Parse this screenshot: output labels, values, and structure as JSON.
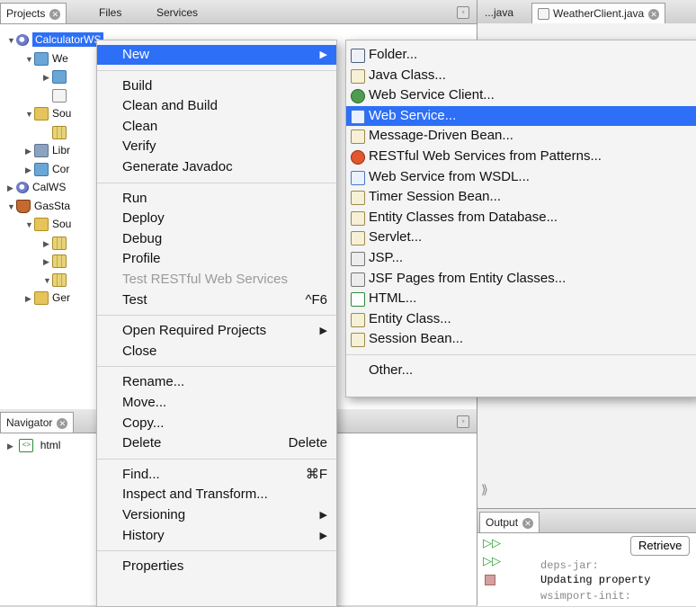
{
  "left_tabs": [
    {
      "label": "Projects",
      "closable": true,
      "active": true
    },
    {
      "label": "Files",
      "closable": false,
      "active": false
    },
    {
      "label": "Services",
      "closable": false,
      "active": false
    }
  ],
  "editor_tabs": [
    {
      "label": "...java"
    },
    {
      "label": "WeatherClient.java",
      "closable": true
    }
  ],
  "project_tree": [
    {
      "indent": 0,
      "expanded": true,
      "icon": "globe-icon",
      "label": "CalculatorWS",
      "selected": true
    },
    {
      "indent": 1,
      "expanded": true,
      "icon": "folder-blue-icon",
      "label": "We"
    },
    {
      "indent": 2,
      "expanded": false,
      "icon": "folder-blue-icon",
      "label": ""
    },
    {
      "indent": 2,
      "expanded": null,
      "icon": "file-icon",
      "label": ""
    },
    {
      "indent": 1,
      "expanded": true,
      "icon": "folder-gold-icon",
      "label": "Sou"
    },
    {
      "indent": 2,
      "expanded": null,
      "icon": "package-icon",
      "label": ""
    },
    {
      "indent": 1,
      "expanded": false,
      "icon": "library-icon",
      "label": "Libr"
    },
    {
      "indent": 1,
      "expanded": false,
      "icon": "folder-blue-icon",
      "label": "Cor"
    },
    {
      "indent": 0,
      "expanded": false,
      "icon": "globe-icon",
      "label": "CalWS"
    },
    {
      "indent": 0,
      "expanded": true,
      "icon": "coffee-cup-icon",
      "label": "GasSta"
    },
    {
      "indent": 1,
      "expanded": true,
      "icon": "folder-gold-icon",
      "label": "Sou"
    },
    {
      "indent": 2,
      "expanded": false,
      "icon": "package-icon",
      "label": ""
    },
    {
      "indent": 2,
      "expanded": false,
      "icon": "package-icon",
      "label": ""
    },
    {
      "indent": 2,
      "expanded": true,
      "icon": "package-icon",
      "label": ""
    },
    {
      "indent": 1,
      "expanded": false,
      "icon": "folder-gold-icon",
      "label": "Ger"
    }
  ],
  "navigator": {
    "tab_label": "Navigator",
    "root": {
      "icon": "html-icon",
      "label": "html"
    }
  },
  "context_menu": {
    "groups": [
      [
        {
          "label": "New",
          "submenu": true,
          "highlighted": true
        }
      ],
      [
        {
          "label": "Build"
        },
        {
          "label": "Clean and Build"
        },
        {
          "label": "Clean"
        },
        {
          "label": "Verify"
        },
        {
          "label": "Generate Javadoc"
        }
      ],
      [
        {
          "label": "Run"
        },
        {
          "label": "Deploy"
        },
        {
          "label": "Debug"
        },
        {
          "label": "Profile"
        },
        {
          "label": "Test RESTful Web Services",
          "disabled": true
        },
        {
          "label": "Test",
          "shortcut": "^F6"
        }
      ],
      [
        {
          "label": "Open Required Projects",
          "submenu": true
        },
        {
          "label": "Close"
        }
      ],
      [
        {
          "label": "Rename..."
        },
        {
          "label": "Move..."
        },
        {
          "label": "Copy..."
        },
        {
          "label": "Delete",
          "shortcut": "Delete"
        }
      ],
      [
        {
          "label": "Find...",
          "shortcut": "⌘F"
        },
        {
          "label": "Inspect and Transform..."
        },
        {
          "label": "Versioning",
          "submenu": true
        },
        {
          "label": "History",
          "submenu": true
        }
      ],
      [
        {
          "label": "Properties"
        }
      ]
    ]
  },
  "new_submenu": {
    "items": [
      {
        "label": "Folder...",
        "icon": "folder-icon"
      },
      {
        "label": "Java Class...",
        "icon": "java-class-icon"
      },
      {
        "label": "Web Service Client...",
        "icon": "web-service-client-icon"
      },
      {
        "label": "Web Service...",
        "icon": "web-service-icon",
        "highlighted": true
      },
      {
        "label": "Message-Driven Bean...",
        "icon": "java-class-icon"
      },
      {
        "label": "RESTful Web Services from Patterns...",
        "icon": "restful-icon"
      },
      {
        "label": "Web Service from WSDL...",
        "icon": "web-service-icon"
      },
      {
        "label": "Timer Session Bean...",
        "icon": "java-class-icon"
      },
      {
        "label": "Entity Classes from Database...",
        "icon": "java-class-icon"
      },
      {
        "label": "Servlet...",
        "icon": "java-class-icon"
      },
      {
        "label": "JSP...",
        "icon": "jsp-icon"
      },
      {
        "label": "JSF Pages from Entity Classes...",
        "icon": "jsp-icon"
      },
      {
        "label": "HTML...",
        "icon": "html-file-icon"
      },
      {
        "label": "Entity Class...",
        "icon": "java-class-icon"
      },
      {
        "label": "Session Bean...",
        "icon": "java-class-icon"
      }
    ],
    "other_label": "Other..."
  },
  "output": {
    "tab_label": "Output",
    "retrieve_button_label": "Retrieve",
    "lines": [
      "deps-jar:",
      "Updating property",
      "wsimport-init:"
    ]
  },
  "colors": {
    "highlight": "#2d6ff7",
    "menu_bg": "#f4f4f4",
    "disabled_text": "#9a9a9a"
  }
}
